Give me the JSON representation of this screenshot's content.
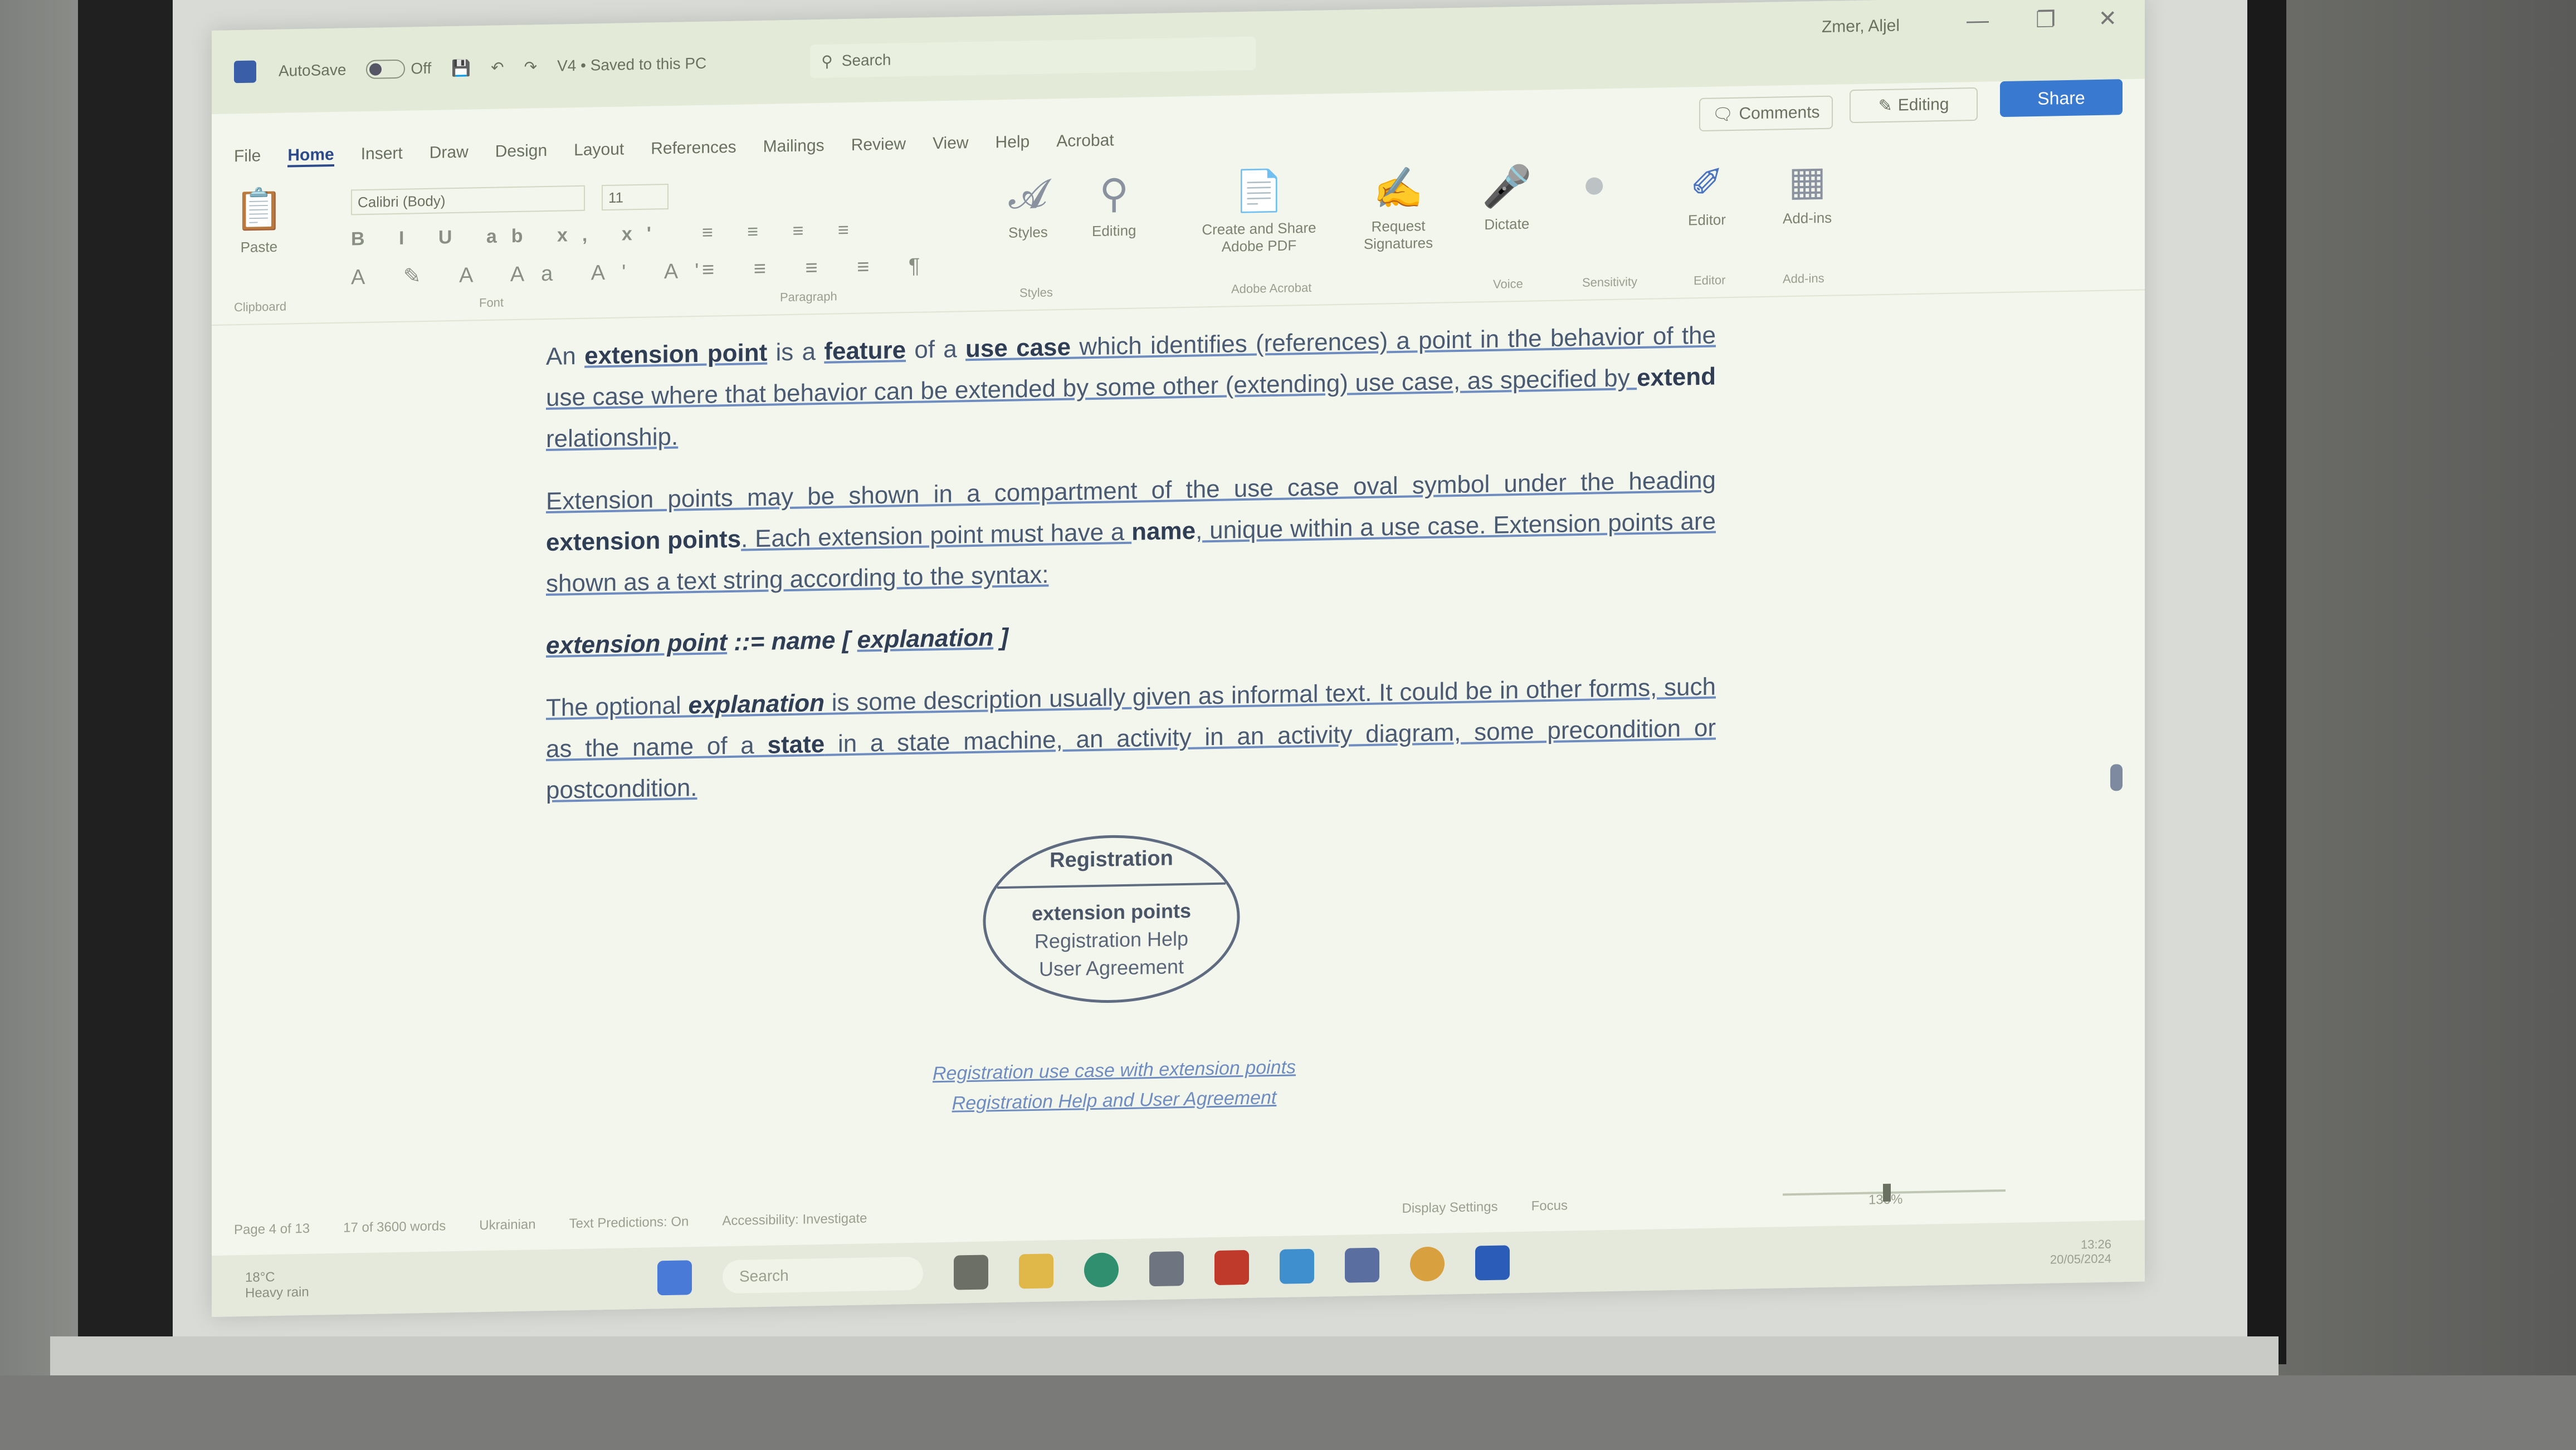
{
  "titlebar": {
    "autosave_label": "AutoSave",
    "autosave_state": "Off",
    "doc_title": "V4 • Saved to this PC",
    "search_placeholder": "Search",
    "user_name": "Zmer, Aljel"
  },
  "header_buttons": {
    "comments": "Comments",
    "editing": "Editing",
    "share": "Share"
  },
  "menu": [
    "File",
    "Home",
    "Insert",
    "Draw",
    "Design",
    "Layout",
    "References",
    "Mailings",
    "Review",
    "View",
    "Help",
    "Acrobat"
  ],
  "menu_active": "Home",
  "ribbon": {
    "font_name": "Calibri (Body)",
    "font_size": "11",
    "paste": "Paste",
    "styles": "Styles",
    "editing": "Editing",
    "create_share": "Create and Share Adobe PDF",
    "request_signatures": "Request Signatures",
    "dictate": "Dictate",
    "sensitivity": "Sensitivity",
    "editor": "Editor",
    "addins": "Add-ins",
    "groups": {
      "clipboard": "Clipboard",
      "font": "Font",
      "paragraph": "Paragraph",
      "styles": "Styles",
      "adobe": "Adobe Acrobat",
      "voice": "Voice",
      "sensitivity": "Sensitivity",
      "editor": "Editor",
      "addins": "Add-ins"
    }
  },
  "document": {
    "p1": [
      "An ",
      "extension point",
      " is a ",
      "feature",
      " of a ",
      "use case",
      " which identifies (references) a point in the behavior of the use case where that behavior can be extended by some other (extending) use case, as specified by ",
      "extend",
      " relationship."
    ],
    "p2": [
      "Extension points may be shown in a compartment of the use case oval symbol under the heading ",
      "extension points",
      ". Each extension point must have a ",
      "name",
      ", unique within a use case. Extension points are shown as a text string according to the syntax:"
    ],
    "syntax": {
      "lhs": "extension point",
      "op": " ::= ",
      "name": "name",
      "open": " [ ",
      "expl": "explanation",
      "close": " ]"
    },
    "p3": [
      "The optional ",
      "explanation",
      " is some description usually given as informal text. It could be in other forms, such as the name of a ",
      "state",
      " in a state machine, an activity in an activity diagram, some precondition or postcondition."
    ]
  },
  "diagram": {
    "name": "Registration",
    "compartment_title": "extension points",
    "points": [
      "Registration Help",
      "User Agreement"
    ]
  },
  "caption": {
    "line1": "Registration use case with extension points",
    "line2": "Registration Help and User Agreement"
  },
  "statusbar": {
    "page": "Page 4 of 13",
    "words": "17 of 3600 words",
    "language": "Ukrainian",
    "predictions": "Text Predictions: On",
    "accessibility": "Accessibility: Investigate",
    "display": "Display Settings",
    "focus": "Focus",
    "zoom": "130%"
  },
  "taskbar": {
    "weather_temp": "18°C",
    "weather_desc": "Heavy rain",
    "search": "Search",
    "time": "13:26",
    "date": "20/05/2024"
  },
  "colors": {
    "share": "#3a79d0",
    "accent": "#2d4a8a",
    "link_underline": "#6f8cc0"
  }
}
